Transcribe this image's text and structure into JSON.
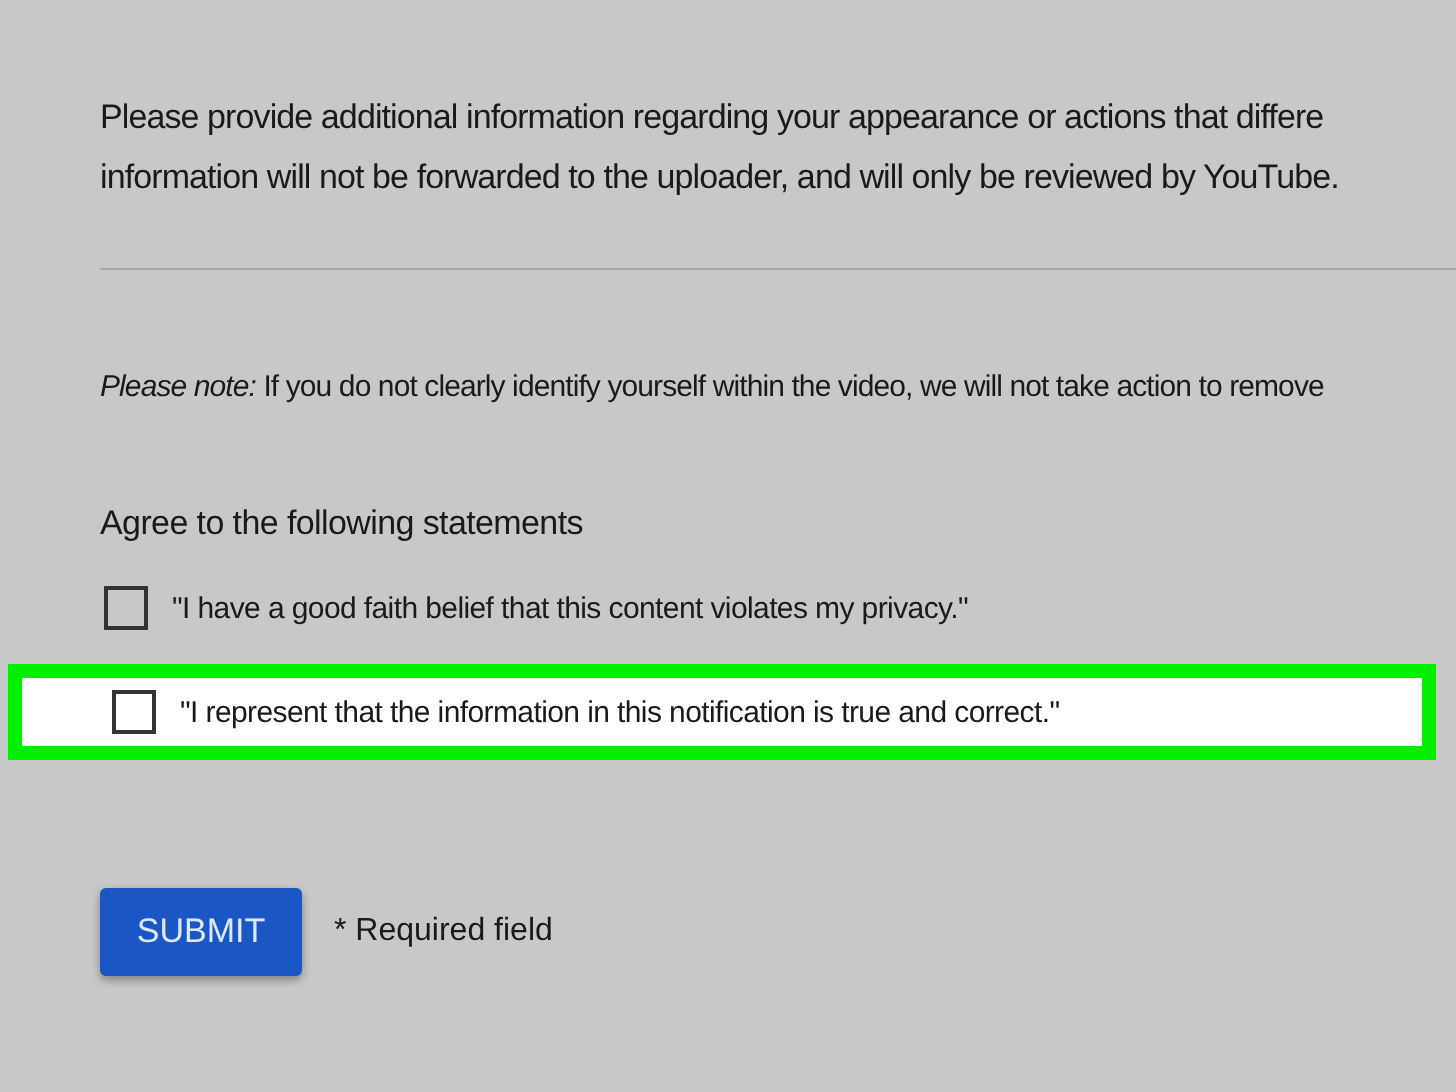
{
  "info_text": [
    "Please provide additional information regarding your appearance or actions that differe",
    "information will not be forwarded to the uploader, and will only be reviewed by YouTube."
  ],
  "note": "*Please note:* If you do not clearly identify yourself within the video, we will not take action to remove",
  "statements": {
    "heading": "Agree to the following statements",
    "items": [
      {
        "label": "\"I have a good faith belief that this content violates my privacy.\"",
        "checked": false,
        "highlighted": false
      },
      {
        "label": "\"I represent that the information in this notification is true and correct.\"",
        "checked": false,
        "highlighted": true
      }
    ]
  },
  "submit_button": "SUBMIT",
  "required_note": "* Required field"
}
